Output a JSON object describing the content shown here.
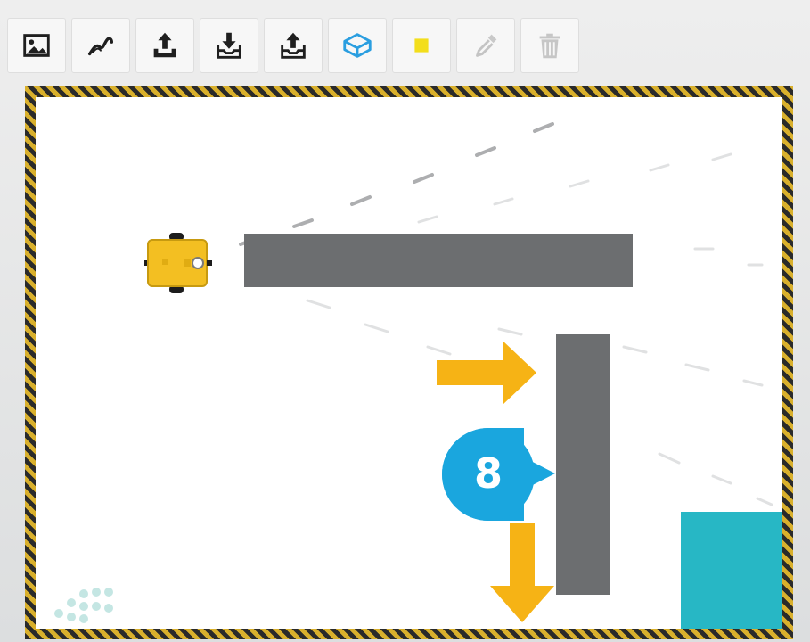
{
  "toolbar": {
    "tools": [
      {
        "icon": "image-icon",
        "name": "background-image-tool"
      },
      {
        "icon": "path-icon",
        "name": "draw-path-tool"
      },
      {
        "icon": "upload-icon",
        "name": "upload-tool"
      },
      {
        "icon": "download-icon",
        "name": "download-tool"
      },
      {
        "icon": "export-icon",
        "name": "export-tool"
      },
      {
        "icon": "box-3d-icon",
        "name": "obstacle-tool"
      },
      {
        "icon": "yellow-square-icon",
        "name": "color-tool"
      },
      {
        "icon": "eyedropper-icon",
        "name": "eyedropper-tool"
      },
      {
        "icon": "trash-icon",
        "name": "delete-tool"
      }
    ]
  },
  "arena": {
    "step_marker_label": "8"
  },
  "colors": {
    "wall": "#6c6e70",
    "goal": "#27b7c5",
    "arrow": "#f6b315",
    "marker": "#1aa6de",
    "robot": "#f3bf22",
    "hazard_dark": "#2a2a2a",
    "hazard_light": "#d9b02c"
  }
}
